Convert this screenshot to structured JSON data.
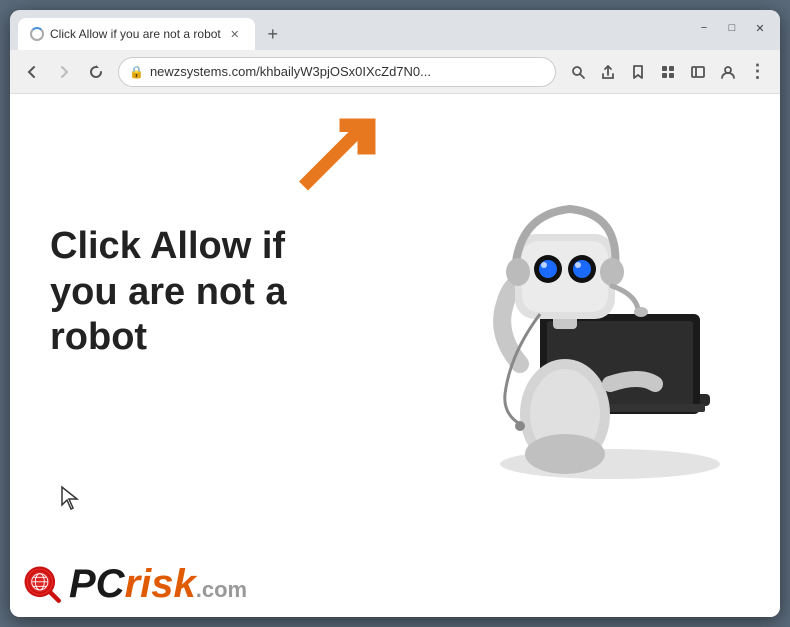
{
  "window": {
    "title": "Click Allow if you are not a robot",
    "tab_label": "Click Allow if you are not a robot",
    "url": "newzsystems.com/khbailyW3pjOSx0IXcZd7N0...",
    "new_tab_label": "+",
    "controls": {
      "minimize": "−",
      "maximize": "□",
      "close": "✕"
    }
  },
  "toolbar": {
    "back_label": "←",
    "forward_label": "→",
    "reload_label": "✕",
    "search_icon": "🔍",
    "share_icon": "⬆",
    "bookmark_icon": "☆",
    "extensions_icon": "🧩",
    "sidebar_icon": "▣",
    "profile_icon": "👤",
    "menu_icon": "⋮"
  },
  "page": {
    "main_text": "Click Allow if you are not a robot",
    "logo_pc": "PC",
    "logo_risk": "risk",
    "logo_com": ".com"
  }
}
